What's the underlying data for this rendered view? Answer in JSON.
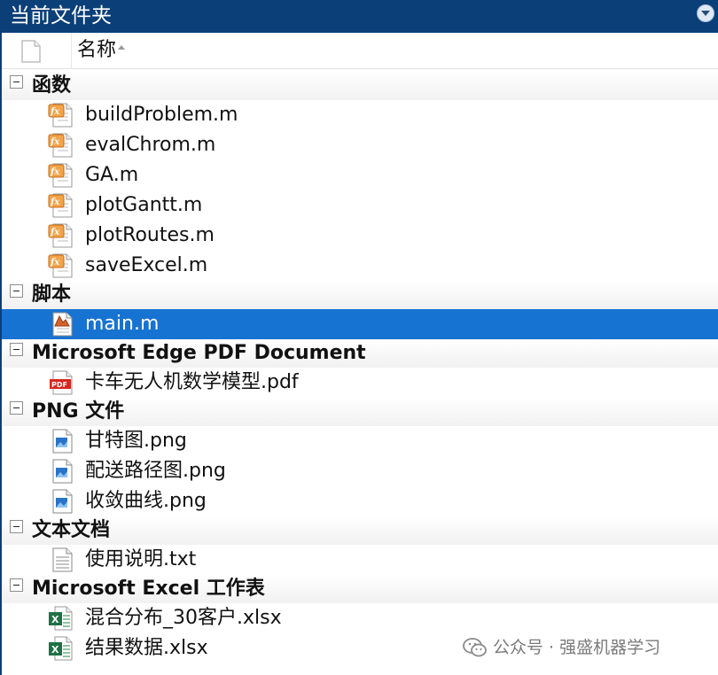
{
  "panel": {
    "title": "当前文件夹"
  },
  "columns": {
    "name": "名称"
  },
  "groups": [
    {
      "label": "函数",
      "files": [
        {
          "name": "buildProblem.m",
          "icon": "matlab-function-icon"
        },
        {
          "name": "evalChrom.m",
          "icon": "matlab-function-icon"
        },
        {
          "name": "GA.m",
          "icon": "matlab-function-icon"
        },
        {
          "name": "plotGantt.m",
          "icon": "matlab-function-icon"
        },
        {
          "name": "plotRoutes.m",
          "icon": "matlab-function-icon"
        },
        {
          "name": "saveExcel.m",
          "icon": "matlab-function-icon"
        }
      ]
    },
    {
      "label": "脚本",
      "files": [
        {
          "name": "main.m",
          "icon": "matlab-script-icon",
          "selected": true
        }
      ]
    },
    {
      "label": "Microsoft Edge PDF Document",
      "files": [
        {
          "name": "卡车无人机数学模型.pdf",
          "icon": "pdf-icon"
        }
      ]
    },
    {
      "label": "PNG 文件",
      "files": [
        {
          "name": "甘特图.png",
          "icon": "png-image-icon"
        },
        {
          "name": "配送路径图.png",
          "icon": "png-image-icon"
        },
        {
          "name": "收敛曲线.png",
          "icon": "png-image-icon"
        }
      ]
    },
    {
      "label": "文本文档",
      "files": [
        {
          "name": "使用说明.txt",
          "icon": "text-document-icon"
        }
      ]
    },
    {
      "label": "Microsoft Excel 工作表",
      "files": [
        {
          "name": "混合分布_30客户.xlsx",
          "icon": "excel-icon"
        },
        {
          "name": "结果数据.xlsx",
          "icon": "excel-icon"
        }
      ]
    }
  ],
  "watermark": {
    "text": "公众号 · 强盛机器学习",
    "icon": "wechat-icon"
  },
  "colors": {
    "title_bar": "#0b3f78",
    "selection": "#1773d1"
  }
}
